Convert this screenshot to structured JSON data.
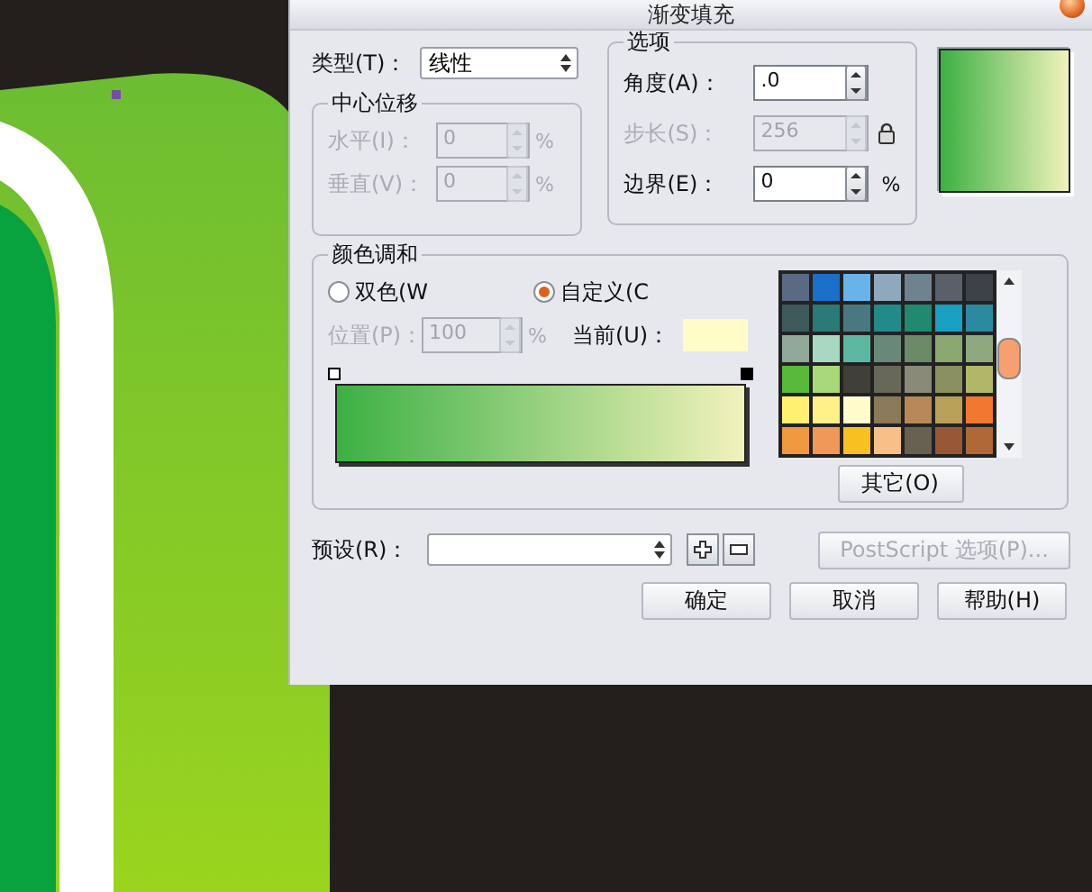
{
  "window": {
    "title": "渐变填充"
  },
  "type": {
    "label": "类型(T)：",
    "value": "线性"
  },
  "center_offset": {
    "title": "中心位移",
    "fields": [
      {
        "label": "水平(I)：",
        "value": "0",
        "unit": "%",
        "disabled": true
      },
      {
        "label": "垂直(V)：",
        "value": "0",
        "unit": "%",
        "disabled": true
      }
    ]
  },
  "options": {
    "title": "选项",
    "fields": [
      {
        "label": "角度(A)：",
        "value": ".0",
        "disabled": false,
        "kind": "plain"
      },
      {
        "label": "步长(S)：",
        "value": "256",
        "disabled": true,
        "kind": "lock"
      },
      {
        "label": "边界(E)：",
        "value": "0",
        "unit": "%",
        "disabled": false,
        "kind": "plain"
      }
    ]
  },
  "blend": {
    "title": "颜色调和",
    "radios": [
      {
        "label": "双色(W",
        "selected": false
      },
      {
        "label": "自定义(C",
        "selected": true
      }
    ],
    "position": {
      "label": "位置(P)：",
      "value": "100",
      "unit": "%",
      "disabled": true
    },
    "current": {
      "label": "当前(U)：",
      "color": "#fffcc8"
    },
    "palette": [
      {
        "color": "#5a6a82",
        "selected": false
      },
      {
        "color": "#1a6fc8",
        "selected": false
      },
      {
        "color": "#66b4ea",
        "selected": false
      },
      {
        "color": "#8fa8bc",
        "selected": false
      },
      {
        "color": "#6e8290",
        "selected": false
      },
      {
        "color": "#5a6068",
        "selected": false
      },
      {
        "color": "#3c4248",
        "selected": false
      },
      {
        "color": "#3e5a5a",
        "selected": false
      },
      {
        "color": "#2a7a78",
        "selected": false
      },
      {
        "color": "#4a7880",
        "selected": false
      },
      {
        "color": "#228a88",
        "selected": false
      },
      {
        "color": "#1f8a70",
        "selected": false
      },
      {
        "color": "#19a0c0",
        "selected": false
      },
      {
        "color": "#2a8aa0",
        "selected": false
      },
      {
        "color": "#90a898",
        "selected": false
      },
      {
        "color": "#a8d8c0",
        "selected": false
      },
      {
        "color": "#5cb8a0",
        "selected": false
      },
      {
        "color": "#6a8878",
        "selected": false
      },
      {
        "color": "#6a8a68",
        "selected": false
      },
      {
        "color": "#8aa870",
        "selected": false
      },
      {
        "color": "#90a880",
        "selected": false
      },
      {
        "color": "#58b838",
        "selected": false
      },
      {
        "color": "#a8d878",
        "selected": false
      },
      {
        "color": "#404038",
        "selected": false
      },
      {
        "color": "#686858",
        "selected": false
      },
      {
        "color": "#8a8a78",
        "selected": false
      },
      {
        "color": "#8a9060",
        "selected": false
      },
      {
        "color": "#b0b868",
        "selected": false
      },
      {
        "color": "#fff070",
        "selected": false
      },
      {
        "color": "#fff088",
        "selected": false
      },
      {
        "color": "#fffcc8",
        "selected": true
      },
      {
        "color": "#8a7a5a",
        "selected": false
      },
      {
        "color": "#b88858",
        "selected": false
      },
      {
        "color": "#b8a058",
        "selected": false
      },
      {
        "color": "#f07830",
        "selected": false
      },
      {
        "color": "#f09840",
        "selected": false
      },
      {
        "color": "#f09858",
        "selected": false
      },
      {
        "color": "#f8c020",
        "selected": false
      },
      {
        "color": "#f8c088",
        "selected": false
      },
      {
        "color": "#686050",
        "selected": false
      },
      {
        "color": "#985838",
        "selected": false
      },
      {
        "color": "#b06838",
        "selected": false
      }
    ],
    "other_button": "其它(O)"
  },
  "preset": {
    "label": "预设(R)："
  },
  "postscript_button": {
    "label": "PostScript 选项(P)...",
    "disabled": true
  },
  "buttons": [
    "确定",
    "取消",
    "帮助(H)"
  ]
}
